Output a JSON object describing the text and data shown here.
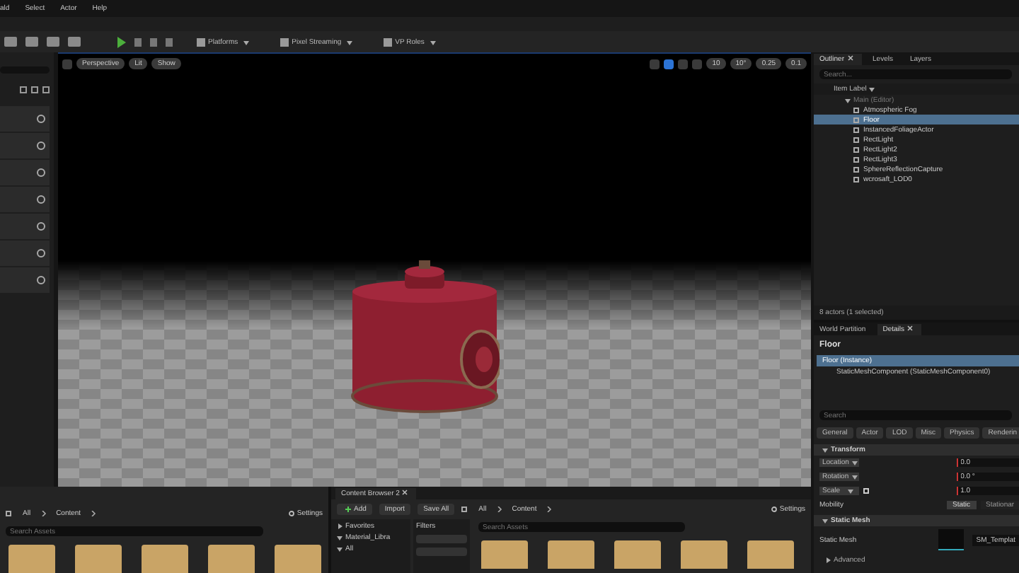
{
  "menu_bar": [
    "ald",
    "Select",
    "Actor",
    "Help"
  ],
  "toolbar": {
    "dropdowns": [
      "Platforms",
      "Pixel Streaming",
      "VP Roles"
    ]
  },
  "viewport": {
    "view_buttons": [
      "Perspective",
      "Lit",
      "Show"
    ],
    "transform_tools": [
      {
        "selected": false
      },
      {
        "selected": true
      },
      {
        "selected": false
      },
      {
        "selected": false
      }
    ],
    "snap_values": [
      "10",
      "10°",
      "0.25",
      "0.1"
    ]
  },
  "outliner": {
    "tabs": [
      {
        "label": "Outliner",
        "selected": true,
        "closable": true
      },
      {
        "label": "Levels",
        "selected": false,
        "closable": false
      },
      {
        "label": "Layers",
        "selected": false,
        "closable": false
      }
    ],
    "search": {
      "placeholder": "Search..."
    },
    "column": "Item Label",
    "items": [
      {
        "label": "Main (Editor)",
        "selected": false,
        "expanded": true,
        "children": [
          {
            "label": "Atmospheric Fog",
            "selected": false
          },
          {
            "label": "Floor",
            "selected": true
          },
          {
            "label": "InstancedFoliageActor",
            "selected": false
          },
          {
            "label": "RectLight",
            "selected": false
          },
          {
            "label": "RectLight2",
            "selected": false
          },
          {
            "label": "RectLight3",
            "selected": false
          },
          {
            "label": "SphereReflectionCapture",
            "selected": false
          },
          {
            "label": "wcrosaft_LOD0",
            "selected": false
          }
        ]
      }
    ],
    "footer": "8 actors (1 selected)"
  },
  "details": {
    "tabs": [
      {
        "label": "World Partition",
        "selected": false
      },
      {
        "label": "Details",
        "selected": true
      }
    ],
    "title": "Floor",
    "components": [
      {
        "label": "Floor (Instance)",
        "selected": true
      },
      {
        "label": "StaticMeshComponent (StaticMeshComponent0)",
        "selected": false
      }
    ],
    "search": {
      "placeholder": "Search"
    },
    "categories": [
      {
        "label": "General",
        "selected": false
      },
      {
        "label": "Actor",
        "selected": false
      },
      {
        "label": "LOD",
        "selected": false
      },
      {
        "label": "Misc",
        "selected": false
      },
      {
        "label": "Physics",
        "selected": false
      },
      {
        "label": "Renderin",
        "selected": false
      }
    ],
    "transform": {
      "title": "Transform",
      "rows": [
        {
          "label": "Location",
          "value": "0.0",
          "locked": false
        },
        {
          "label": "Rotation",
          "value": "0.0 °",
          "locked": false
        },
        {
          "label": "Scale",
          "value": "1.0",
          "locked": true
        }
      ],
      "mobility": {
        "label": "Mobility",
        "options": [
          {
            "label": "Static",
            "selected": true
          },
          {
            "label": "Stationar",
            "selected": false
          }
        ]
      }
    },
    "static_mesh": {
      "title": "Static Mesh",
      "label": "Static Mesh",
      "asset": "SM_Templat"
    },
    "advanced": "Advanced"
  },
  "content_browser": {
    "path": [
      "All",
      "Content"
    ],
    "settings": "Settings",
    "search": {
      "placeholder": "Search Assets"
    }
  },
  "content_browser_2": {
    "tab": "Content Browser 2",
    "actions": [
      "Add",
      "Import",
      "Save All"
    ],
    "path": [
      "All",
      "Content"
    ],
    "settings": "Settings",
    "tree": [
      {
        "label": "Favorites",
        "expanded": false
      },
      {
        "label": "Material_Libra",
        "expanded": true
      }
    ],
    "tree_root": "All",
    "filters": "Filters",
    "search": {
      "placeholder": "Search Assets"
    }
  }
}
